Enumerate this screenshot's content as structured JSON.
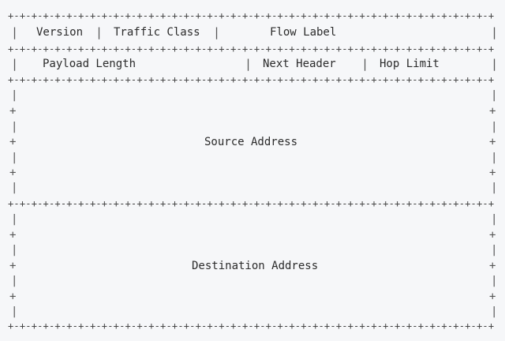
{
  "fields": {
    "version": "Version",
    "traffic_class": "Traffic Class",
    "flow_label": "Flow Label",
    "payload_length": "Payload Length",
    "next_header": "Next Header",
    "hop_limit": "Hop Limit",
    "source_address": "Source Address",
    "destination_address": "Destination Address"
  },
  "glyphs": {
    "border_segment": "+-",
    "side_bar": "|",
    "side_plus": "+"
  }
}
